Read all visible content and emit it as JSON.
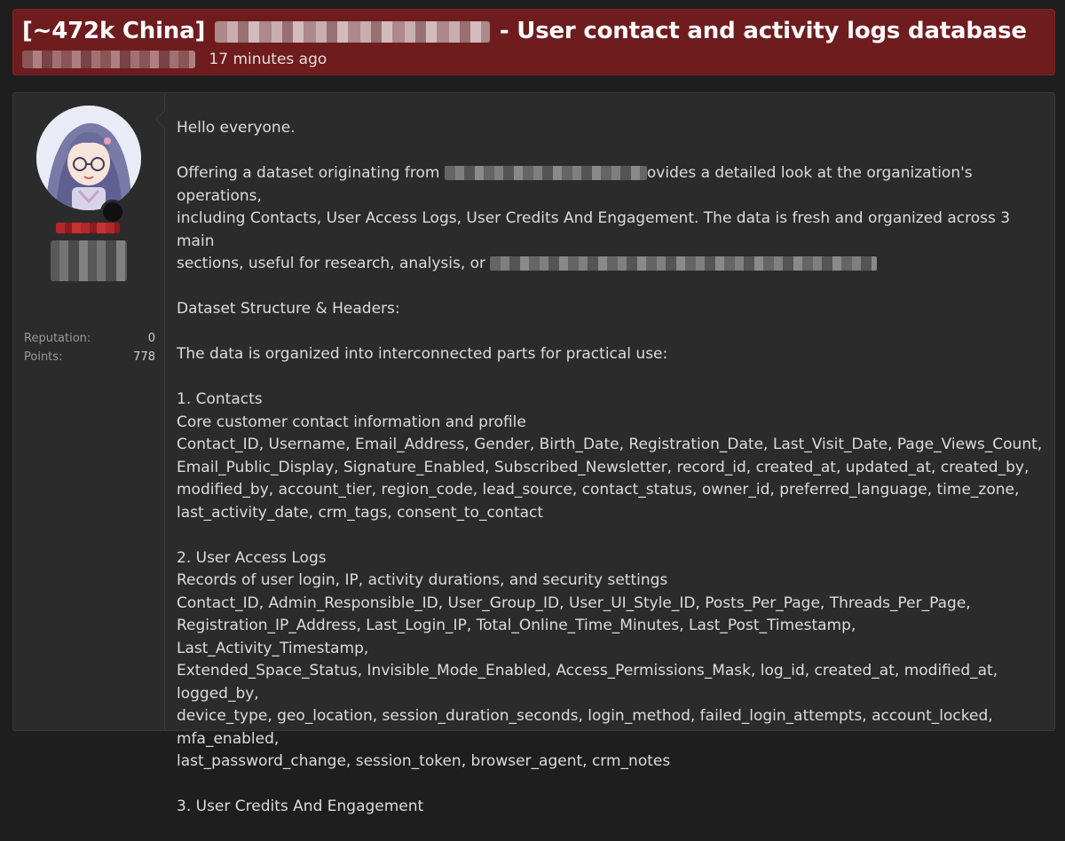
{
  "header": {
    "title_prefix": "[~472k China]",
    "title_suffix": "- User contact and activity logs database",
    "timestamp": "17 minutes ago"
  },
  "user": {
    "stats": [
      {
        "label": "Reputation:",
        "value": "0"
      },
      {
        "label": "Points:",
        "value": "778"
      }
    ]
  },
  "post": {
    "greeting": "Hello everyone.",
    "intro_part1": "Offering a dataset originating from",
    "intro_part2": "ovides a detailed look at the organization's operations,",
    "intro_line2": "including Contacts, User Access Logs, User Credits And Engagement. The data is fresh and organized across 3 main",
    "intro_line3": "sections, useful for research, analysis, or",
    "structure_heading": "Dataset Structure & Headers:",
    "structure_intro": "The data is organized into interconnected parts for practical use:",
    "sections": [
      {
        "heading": "1. Contacts",
        "description": "Core customer contact information and profile",
        "fields": [
          "Contact_ID, Username, Email_Address, Gender, Birth_Date, Registration_Date, Last_Visit_Date, Page_Views_Count,",
          "Email_Public_Display, Signature_Enabled, Subscribed_Newsletter, record_id, created_at, updated_at, created_by,",
          "modified_by, account_tier, region_code, lead_source, contact_status, owner_id, preferred_language, time_zone,",
          "last_activity_date, crm_tags, consent_to_contact"
        ]
      },
      {
        "heading": "2. User Access Logs",
        "description": "Records of user login, IP, activity durations, and security settings",
        "fields": [
          "Contact_ID, Admin_Responsible_ID, User_Group_ID, User_UI_Style_ID, Posts_Per_Page, Threads_Per_Page,",
          "Registration_IP_Address, Last_Login_IP, Total_Online_Time_Minutes, Last_Post_Timestamp, Last_Activity_Timestamp,",
          "Extended_Space_Status, Invisible_Mode_Enabled, Access_Permissions_Mask, log_id, created_at, modified_at, logged_by,",
          "device_type, geo_location, session_duration_seconds, login_method, failed_login_attempts, account_locked, mfa_enabled,",
          "last_password_change, session_token, browser_agent, crm_notes"
        ]
      },
      {
        "heading": "3. User Credits And Engagement"
      }
    ]
  }
}
